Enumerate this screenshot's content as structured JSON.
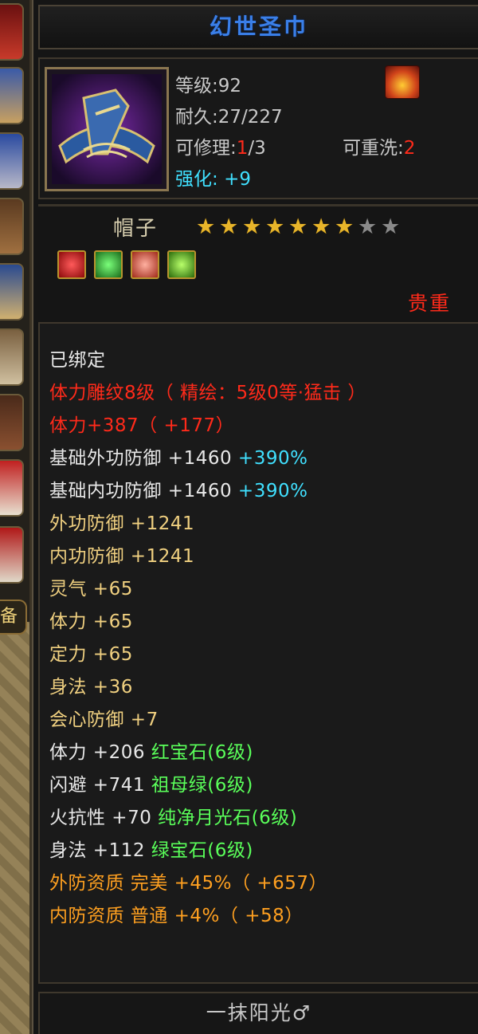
{
  "item": {
    "name": "幻世圣巾",
    "level_label": "等级",
    "level": "92",
    "durability_label": "耐久",
    "durability": "27/227",
    "repair_label": "可修理",
    "repair_used": "1",
    "repair_total": "/3",
    "rewash_label": "可重洗",
    "rewash_value": "2",
    "enhance_label": "强化",
    "enhance_value": "+9",
    "type": "帽子",
    "stars_filled": 7,
    "stars_total": 9,
    "rarity": "贵重"
  },
  "attributes": [
    {
      "text": "已绑定",
      "color": "#e8e8e8"
    },
    {
      "text": "体力雕纹8级（ 精绘：5级0等·猛击 ）",
      "color": "#ff2a1a"
    },
    {
      "text": "体力+387（ +177）",
      "color": "#ff2a1a"
    },
    {
      "text": "基础外功防御 +1460",
      "color": "#e8e8e8",
      "extra": "+390%",
      "extra_color": "#40e0ff"
    },
    {
      "text": "基础内功防御 +1460",
      "color": "#e8e8e8",
      "extra": "+390%",
      "extra_color": "#40e0ff"
    },
    {
      "text": "外功防御 +1241",
      "color": "#f0d080"
    },
    {
      "text": "内功防御 +1241",
      "color": "#f0d080"
    },
    {
      "text": "灵气 +65",
      "color": "#f0d080"
    },
    {
      "text": "体力 +65",
      "color": "#f0d080"
    },
    {
      "text": "定力 +65",
      "color": "#f0d080"
    },
    {
      "text": "身法 +36",
      "color": "#f0d080"
    },
    {
      "text": "会心防御 +7",
      "color": "#f0d080"
    },
    {
      "text": "体力 +206",
      "color": "#e8e8e8",
      "extra": "红宝石(6级)",
      "extra_color": "#5aff5a"
    },
    {
      "text": "闪避 +741",
      "color": "#e8e8e8",
      "extra": "祖母绿(6级)",
      "extra_color": "#5aff5a"
    },
    {
      "text": "火抗性 +70",
      "color": "#e8e8e8",
      "extra": "纯净月光石(6级)",
      "extra_color": "#5aff5a"
    },
    {
      "text": "身法 +112",
      "color": "#e8e8e8",
      "extra": "绿宝石(6级)",
      "extra_color": "#5aff5a"
    },
    {
      "text": "外防资质  完美 +45%（ +657）",
      "color": "#ffa020"
    },
    {
      "text": "内防资质  普通 +4%（ +58）",
      "color": "#ffa020"
    }
  ],
  "footer": {
    "owner": "一抹阳光♂"
  },
  "side_tab": {
    "label": "备"
  },
  "colors": {
    "title": "#3a7fe8",
    "red": "#ff2a1a",
    "cyan": "#40e0ff",
    "gold_star": "#e8b52a"
  },
  "icons": {
    "badge": "flame-emblem-icon",
    "gems": [
      "red-gem-icon",
      "green-gem-icon",
      "feather-gem-icon",
      "jade-gem-icon"
    ]
  }
}
